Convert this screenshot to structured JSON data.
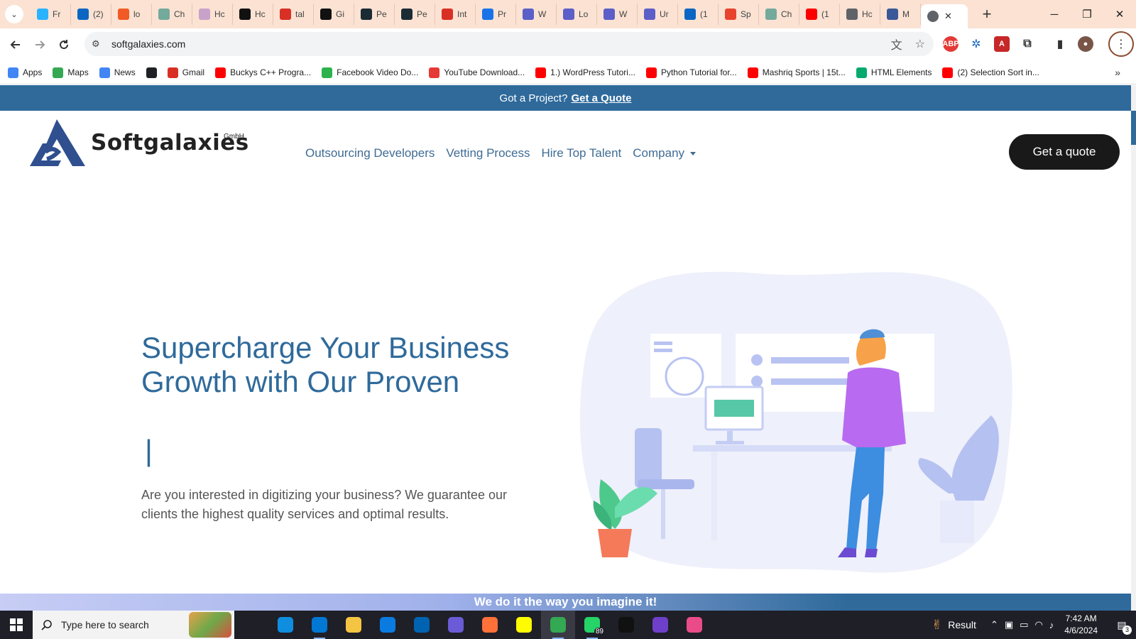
{
  "browser": {
    "tabs": [
      {
        "label": "Fr",
        "icon": "freelancer-icon",
        "color": "#29b2fe"
      },
      {
        "label": "(2)",
        "icon": "linkedin-icon",
        "color": "#0a66c2"
      },
      {
        "label": "lo",
        "icon": "generic-orange-icon",
        "color": "#f15a24"
      },
      {
        "label": "Ch",
        "icon": "chatgpt-icon",
        "color": "#74aa9c"
      },
      {
        "label": "Hc",
        "icon": "generic-site-icon",
        "color": "#c8a2c8"
      },
      {
        "label": "Hc",
        "icon": "github-icon",
        "color": "#111111"
      },
      {
        "label": "tal",
        "icon": "gmail-icon",
        "color": "#d93025"
      },
      {
        "label": "Gi",
        "icon": "github-icon",
        "color": "#111111"
      },
      {
        "label": "Pe",
        "icon": "react-icon",
        "color": "#1b2b34"
      },
      {
        "label": "Pe",
        "icon": "react-icon",
        "color": "#1b2b34"
      },
      {
        "label": "Int",
        "icon": "gmail-icon",
        "color": "#d93025"
      },
      {
        "label": "Pr",
        "icon": "generic-blue-icon",
        "color": "#1a73e8"
      },
      {
        "label": "W",
        "icon": "teams-icon",
        "color": "#5b5fc7"
      },
      {
        "label": "Lo",
        "icon": "teams-icon",
        "color": "#5b5fc7"
      },
      {
        "label": "W",
        "icon": "teams-icon",
        "color": "#5b5fc7"
      },
      {
        "label": "Ur",
        "icon": "teams-icon",
        "color": "#5b5fc7"
      },
      {
        "label": "(1",
        "icon": "linkedin-icon",
        "color": "#0a66c2"
      },
      {
        "label": "Sp",
        "icon": "generic-red-icon",
        "color": "#e8432d"
      },
      {
        "label": "Ch",
        "icon": "chatgpt-icon",
        "color": "#74aa9c"
      },
      {
        "label": "(1",
        "icon": "youtube-icon",
        "color": "#ff0000"
      },
      {
        "label": "Hc",
        "icon": "globe-icon",
        "color": "#5f6368"
      },
      {
        "label": "M",
        "icon": "generic-site-icon",
        "color": "#3b5998"
      }
    ],
    "active_tab": {
      "icon": "globe-icon",
      "close": "✕"
    },
    "new_tab": "+",
    "window": {
      "minimize": "─",
      "restore": "❐",
      "close": "✕"
    },
    "url": "softgalaxies.com",
    "bookmarks": [
      {
        "label": "Apps",
        "icon": "apps-grid-icon",
        "color": "#4285f4"
      },
      {
        "label": "Maps",
        "icon": "maps-icon",
        "color": "#34a853"
      },
      {
        "label": "News",
        "icon": "news-icon",
        "color": "#4285f4"
      },
      {
        "label": "",
        "icon": "globe-icon",
        "color": "#202124"
      },
      {
        "label": "Gmail",
        "icon": "gmail-icon",
        "color": "#d93025"
      },
      {
        "label": "Buckys C++ Progra...",
        "icon": "youtube-icon",
        "color": "#ff0000"
      },
      {
        "label": "Facebook Video Do...",
        "icon": "download-icon",
        "color": "#2bb24c"
      },
      {
        "label": "YouTube Download...",
        "icon": "download-icon",
        "color": "#e53935"
      },
      {
        "label": "1.) WordPress Tutori...",
        "icon": "youtube-icon",
        "color": "#ff0000"
      },
      {
        "label": "Python Tutorial for...",
        "icon": "youtube-icon",
        "color": "#ff0000"
      },
      {
        "label": "Mashriq Sports | 15t...",
        "icon": "youtube-icon",
        "color": "#ff0000"
      },
      {
        "label": "HTML Elements",
        "icon": "w3schools-icon",
        "color": "#04aa6d"
      },
      {
        "label": "(2) Selection Sort in...",
        "icon": "youtube-icon",
        "color": "#ff0000"
      }
    ],
    "bookmarks_more": "»"
  },
  "page": {
    "promo_text": "Got a Project?",
    "promo_link": "Get a Quote",
    "logo_word": "Softgalaxies",
    "logo_sup": "GmbH",
    "nav": [
      "Outsourcing Developers",
      "Vetting Process",
      "Hire Top Talent",
      "Company"
    ],
    "cta": "Get a quote",
    "hero_title": "Supercharge Your Business Growth with Our Proven",
    "hero_cursor": "|",
    "hero_text": "Are you interested in digitizing your business? We guarantee our clients the highest quality services and optimal results.",
    "band_text": "We do it the way you imagine it!",
    "brand_color": "#2f6a9b"
  },
  "taskbar": {
    "search_placeholder": "Type here to search",
    "apps": [
      {
        "icon": "task-view-icon",
        "color": "#1f1f28"
      },
      {
        "icon": "edge-icon",
        "color": "#0f8ee0"
      },
      {
        "icon": "vscode-icon",
        "color": "#0078d4"
      },
      {
        "icon": "file-explorer-icon",
        "color": "#f4c542"
      },
      {
        "icon": "store-icon",
        "color": "#0a7be0"
      },
      {
        "icon": "mail-icon",
        "color": "#0063b1"
      },
      {
        "icon": "power-automate-icon",
        "color": "#6b5bd6"
      },
      {
        "icon": "firefox-icon",
        "color": "#ff7139"
      },
      {
        "icon": "snapchat-icon",
        "color": "#fffc00"
      },
      {
        "icon": "chrome-icon",
        "color": "#34a853"
      },
      {
        "icon": "whatsapp-icon",
        "color": "#25d366",
        "badge": "89"
      },
      {
        "icon": "terminal-icon",
        "color": "#111111"
      },
      {
        "icon": "github-desktop-icon",
        "color": "#6e40c9"
      },
      {
        "icon": "creative-cloud-icon",
        "color": "#ea4c89"
      }
    ],
    "result_label": "Result",
    "time": "7:42 AM",
    "date": "4/6/2024",
    "notifications": "3"
  }
}
